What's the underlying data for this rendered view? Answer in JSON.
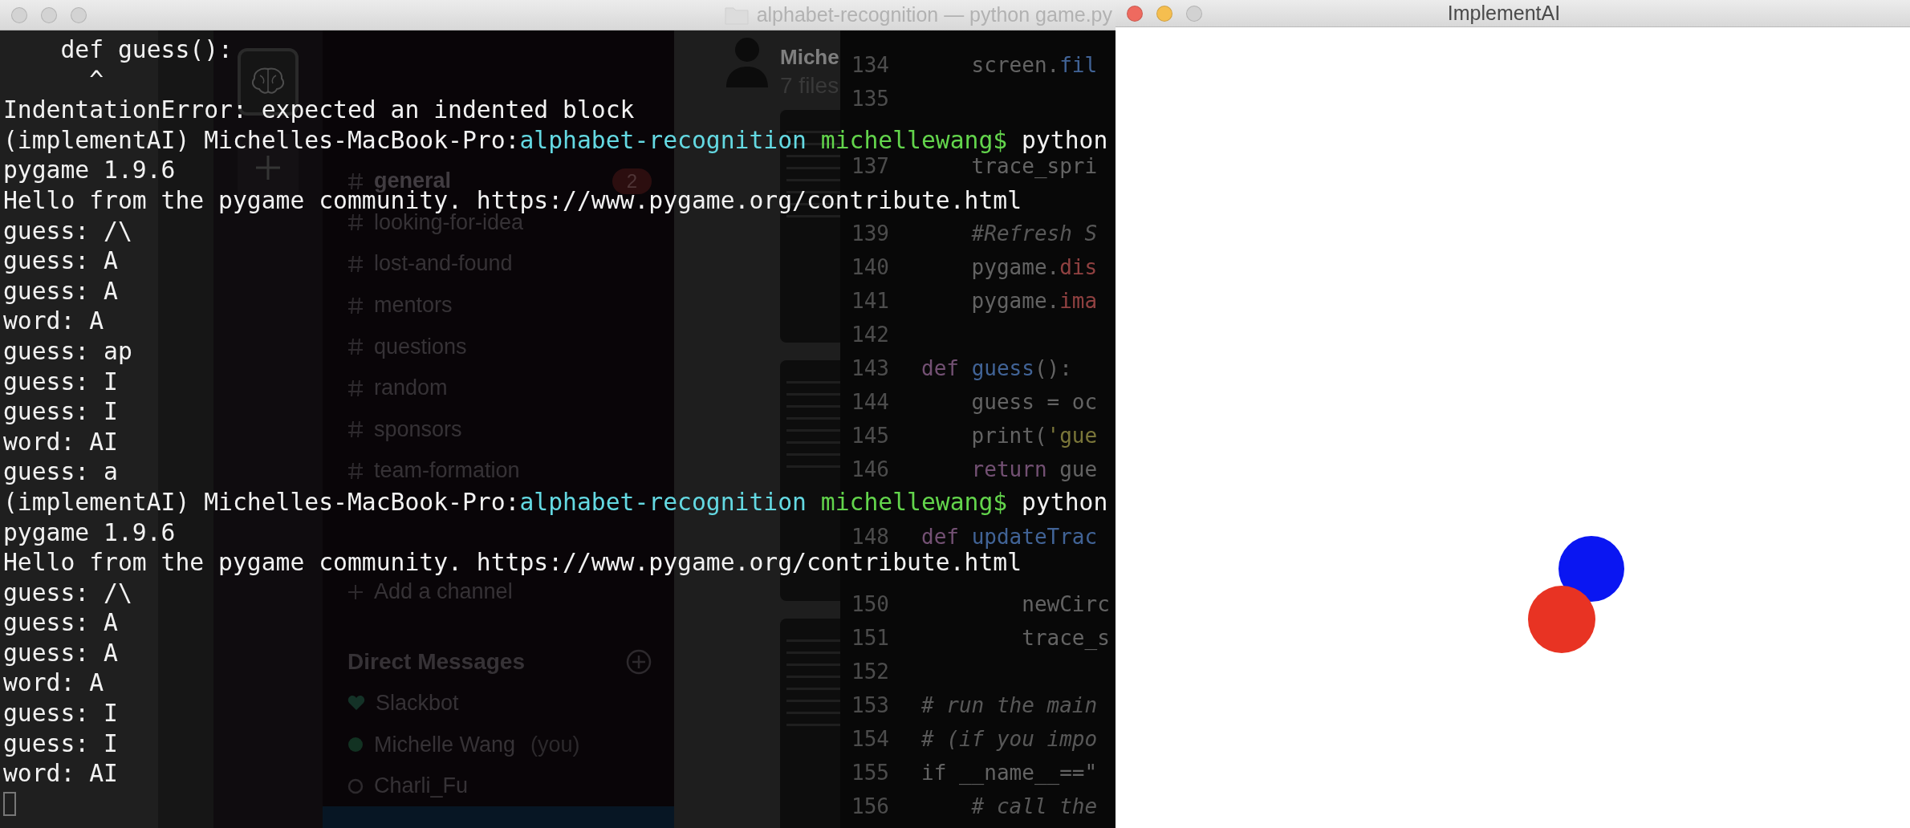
{
  "terminal": {
    "title": "alphabet-recognition — python game.py",
    "active": false,
    "cursor": true,
    "lines": [
      {
        "kind": "output",
        "text": "    def guess():"
      },
      {
        "kind": "output",
        "text": "      ^"
      },
      {
        "kind": "output",
        "text": "IndentationError: expected an indented block"
      },
      {
        "kind": "prompt",
        "host": "(implementAI) Michelles-MacBook-Pro:",
        "path": "alphabet-recognition",
        "user": "michellewang$",
        "command": "python"
      },
      {
        "kind": "output",
        "text": "pygame 1.9.6"
      },
      {
        "kind": "output",
        "text": "Hello from the pygame community. https://www.pygame.org/contribute.html"
      },
      {
        "kind": "output",
        "text": "guess: /\\"
      },
      {
        "kind": "output",
        "text": "guess: A"
      },
      {
        "kind": "output",
        "text": "guess: A"
      },
      {
        "kind": "output",
        "text": "word: A"
      },
      {
        "kind": "output",
        "text": "guess: ap"
      },
      {
        "kind": "output",
        "text": "guess: I"
      },
      {
        "kind": "output",
        "text": "guess: I"
      },
      {
        "kind": "output",
        "text": "word: AI"
      },
      {
        "kind": "output",
        "text": "guess: a"
      },
      {
        "kind": "prompt",
        "host": "(implementAI) Michelles-MacBook-Pro:",
        "path": "alphabet-recognition",
        "user": "michellewang$",
        "command": "python"
      },
      {
        "kind": "output",
        "text": "pygame 1.9.6"
      },
      {
        "kind": "output",
        "text": "Hello from the pygame community. https://www.pygame.org/contribute.html"
      },
      {
        "kind": "output",
        "text": "guess: /\\"
      },
      {
        "kind": "output",
        "text": "guess: A"
      },
      {
        "kind": "output",
        "text": "guess: A"
      },
      {
        "kind": "output",
        "text": "word: A"
      },
      {
        "kind": "output",
        "text": "guess: I"
      },
      {
        "kind": "output",
        "text": "guess: I"
      },
      {
        "kind": "output",
        "text": "word: AI"
      }
    ]
  },
  "slack": {
    "channels": [
      {
        "name": "general",
        "unread": true,
        "badge": "2"
      },
      {
        "name": "looking-for-idea",
        "unread": false
      },
      {
        "name": "lost-and-found",
        "unread": false
      },
      {
        "name": "mentors",
        "unread": false
      },
      {
        "name": "questions",
        "unread": false
      },
      {
        "name": "random",
        "unread": false
      },
      {
        "name": "sponsors",
        "unread": false
      },
      {
        "name": "team-formation",
        "unread": false
      }
    ],
    "add_channel": "Add a channel",
    "dm_header": "Direct Messages",
    "dms": [
      {
        "kind": "bot",
        "name": "Slackbot"
      },
      {
        "kind": "online",
        "name": "Michelle Wang",
        "suffix": "(you)"
      },
      {
        "kind": "away",
        "name": "Charli_Fu"
      }
    ],
    "files_panel": {
      "user": "Miche",
      "count": "7 files"
    }
  },
  "editor": {
    "blocks": [
      {
        "lines": [
          {
            "number": "134",
            "segments": [
              {
                "text": "    screen.",
                "kind": "plain"
              },
              {
                "text": "fil",
                "kind": "name"
              }
            ]
          },
          {
            "number": "135"
          }
        ]
      },
      {
        "lines": [
          {
            "number": "137",
            "segments": [
              {
                "text": "    trace_spri",
                "kind": "plain"
              }
            ]
          }
        ]
      },
      {
        "lines": [
          {
            "number": "139",
            "segments": [
              {
                "text": "    #Refresh S",
                "kind": "comment"
              }
            ]
          },
          {
            "number": "140",
            "segments": [
              {
                "text": "    pygame.",
                "kind": "plain"
              },
              {
                "text": "dis",
                "kind": "attr"
              }
            ]
          },
          {
            "number": "141",
            "segments": [
              {
                "text": "    pygame.",
                "kind": "plain"
              },
              {
                "text": "ima",
                "kind": "attr"
              }
            ]
          },
          {
            "number": "142"
          },
          {
            "number": "143",
            "segments": [
              {
                "text": "def ",
                "kind": "keyword"
              },
              {
                "text": "guess",
                "kind": "name"
              },
              {
                "text": "():",
                "kind": "plain"
              }
            ]
          },
          {
            "number": "144",
            "segments": [
              {
                "text": "    guess = oc",
                "kind": "plain"
              }
            ]
          },
          {
            "number": "145",
            "segments": [
              {
                "text": "    print(",
                "kind": "plain"
              },
              {
                "text": "'gue",
                "kind": "string"
              }
            ]
          },
          {
            "number": "146",
            "segments": [
              {
                "text": "    return",
                "kind": "keyword"
              },
              {
                "text": " gue",
                "kind": "plain"
              }
            ]
          }
        ]
      },
      {
        "lines": [
          {
            "number": "148",
            "segments": [
              {
                "text": "def ",
                "kind": "keyword"
              },
              {
                "text": "updateTrac",
                "kind": "name"
              }
            ]
          }
        ]
      },
      {
        "lines": [
          {
            "number": "150",
            "segments": [
              {
                "text": "        newCirc",
                "kind": "plain"
              }
            ]
          },
          {
            "number": "151",
            "segments": [
              {
                "text": "        trace_s",
                "kind": "plain"
              }
            ]
          },
          {
            "number": "152"
          },
          {
            "number": "153",
            "segments": [
              {
                "text": "# run the main",
                "kind": "comment"
              }
            ]
          },
          {
            "number": "154",
            "segments": [
              {
                "text": "# (if you impo",
                "kind": "comment"
              }
            ]
          },
          {
            "number": "155",
            "segments": [
              {
                "text": "if __name__==\"",
                "kind": "plain"
              }
            ]
          },
          {
            "number": "156",
            "segments": [
              {
                "text": "    # call the",
                "kind": "comment"
              }
            ]
          }
        ]
      }
    ]
  },
  "game": {
    "title": "ImplementAI",
    "active": true,
    "circles": [
      {
        "color": "#0a16f2"
      },
      {
        "color": "#e83323"
      }
    ]
  }
}
